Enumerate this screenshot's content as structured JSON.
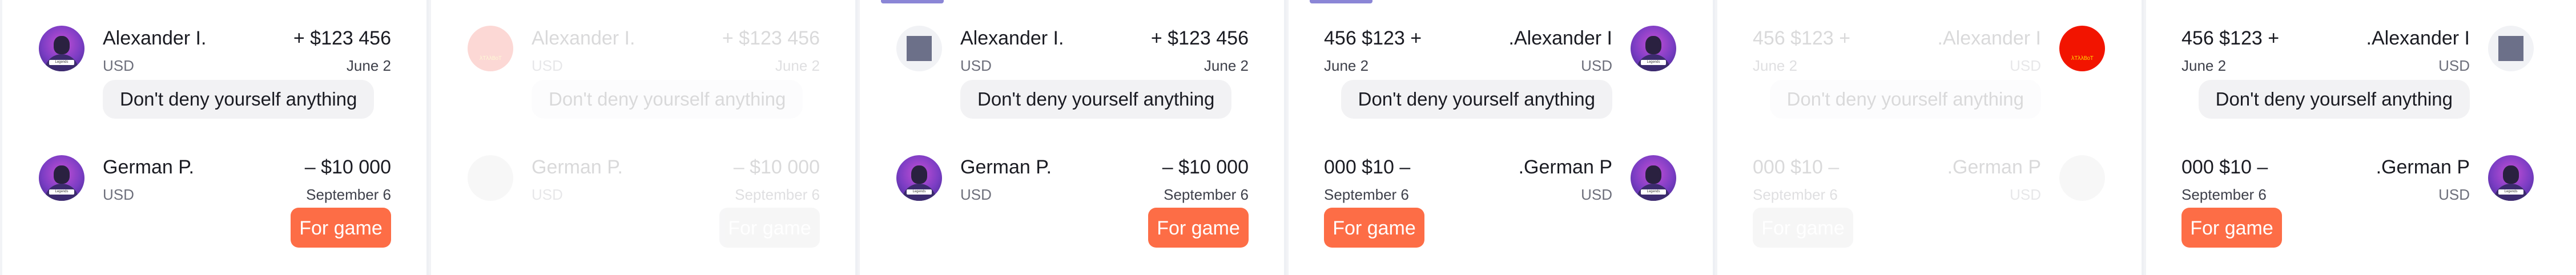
{
  "transactions": {
    "t1": {
      "name": "Alexander I.",
      "currency": "USD",
      "amount": "+ $123 456",
      "date": "June 2",
      "message": "Don't deny yourself anything"
    },
    "t2": {
      "name": "German P.",
      "currency": "USD",
      "amount": "– $10 000",
      "date": "September 6",
      "action": "For game"
    }
  },
  "rtl": {
    "t1": {
      "name": ".Alexander I",
      "amount": "456 $123 +"
    },
    "t2": {
      "name": ".German P",
      "amount": "000 $10 –"
    }
  },
  "avatars": {
    "photo_tag": "Legends",
    "broken_image_text": "λTλλBoT"
  },
  "colors": {
    "accent_button": "#fd6d46",
    "bubble_bg": "#f2f2f4",
    "broken_avatar": "#f21400",
    "placeholder_square": "#6c7089",
    "top_accent": "#8b86d6"
  }
}
